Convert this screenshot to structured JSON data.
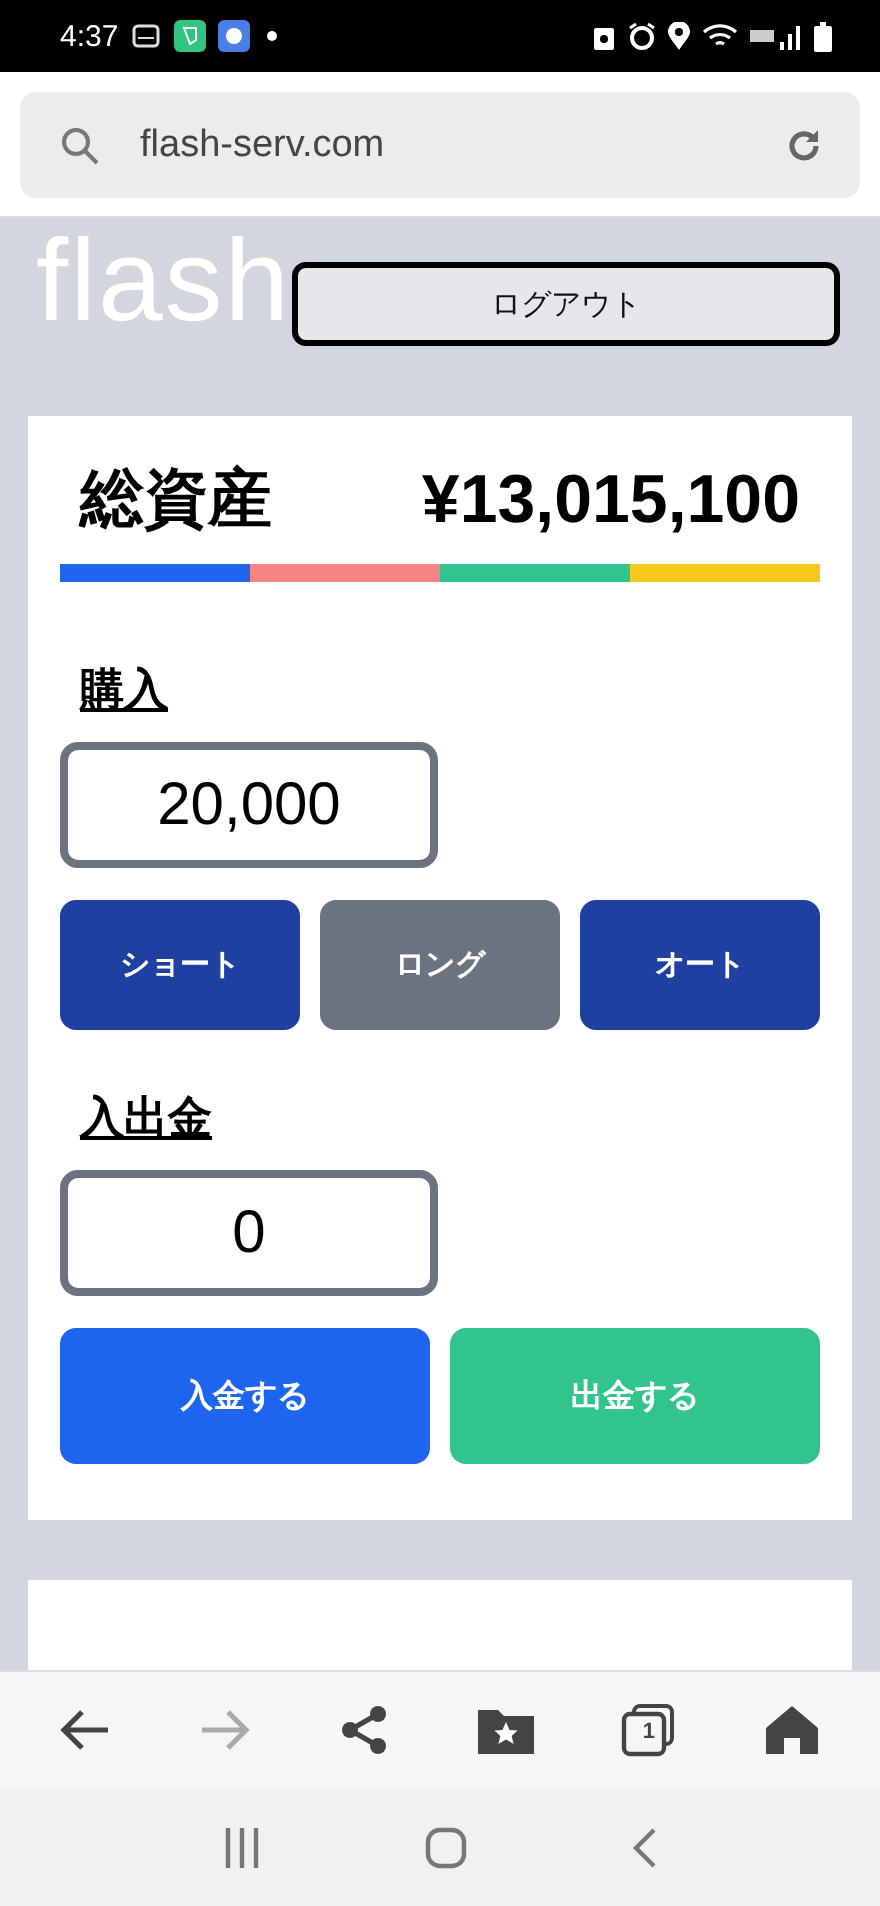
{
  "status_bar": {
    "time": "4:37"
  },
  "address_bar": {
    "url": "flash-serv.com"
  },
  "header": {
    "logo": "flash",
    "logout_button": "ログアウト"
  },
  "assets_card": {
    "title": "総資産",
    "total": "¥13,015,100",
    "segments": [
      {
        "color": "#1f66ee"
      },
      {
        "color": "#f58482"
      },
      {
        "color": "#30c48e"
      },
      {
        "color": "#f8c81c"
      }
    ]
  },
  "purchase": {
    "heading": "購入",
    "amount": "20,000",
    "buttons": [
      {
        "label": "ショート",
        "selected": false
      },
      {
        "label": "ロング",
        "selected": true
      },
      {
        "label": "オート",
        "selected": false
      }
    ]
  },
  "transfer": {
    "heading": "入出金",
    "amount": "0",
    "buttons": [
      {
        "label": "入金する",
        "kind": "deposit"
      },
      {
        "label": "出金する",
        "kind": "withdraw"
      }
    ]
  },
  "browser_toolbar": {
    "items": [
      {
        "kind": "back",
        "disabled": false
      },
      {
        "kind": "forward",
        "disabled": true
      },
      {
        "kind": "share",
        "disabled": false
      },
      {
        "kind": "bookmarks",
        "disabled": false
      },
      {
        "kind": "tabs",
        "disabled": false,
        "count": "1"
      },
      {
        "kind": "home",
        "disabled": false
      }
    ]
  }
}
